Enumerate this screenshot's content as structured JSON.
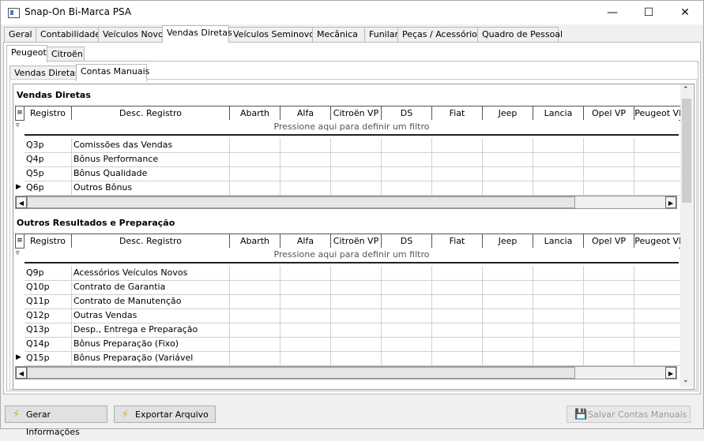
{
  "window": {
    "title": "Snap-On Bi-Marca PSA"
  },
  "main_tabs": [
    "Geral",
    "Contabilidade",
    "Veículos Novos",
    "Vendas Diretas",
    "Veículos Seminovos",
    "Mecânica",
    "Funilaria",
    "Peças / Acessórios",
    "Quadro de Pessoal"
  ],
  "brand_tabs": [
    "Peugeot",
    "Citroën"
  ],
  "sub_tabs": [
    "Vendas Diretas",
    "Contas Manuais"
  ],
  "columns": [
    "Registro",
    "Desc. Registro",
    "Abarth",
    "Alfa",
    "Citroën VP",
    "DS",
    "Fiat",
    "Jeep",
    "Lancia",
    "Opel VP",
    "Peugeot VP"
  ],
  "filter_hint": "Pressione aqui para definir um filtro",
  "section1": {
    "title": "Vendas Diretas",
    "rows": [
      {
        "reg": "Q3p",
        "desc": "Comissões das Vendas"
      },
      {
        "reg": "Q4p",
        "desc": "Bônus Performance"
      },
      {
        "reg": "Q5p",
        "desc": "Bônus Qualidade"
      },
      {
        "reg": "Q6p",
        "desc": "Outros Bônus"
      }
    ]
  },
  "section2": {
    "title": "Outros Resultados e Preparação",
    "rows": [
      {
        "reg": "Q9p",
        "desc": "Acessórios Veículos Novos"
      },
      {
        "reg": "Q10p",
        "desc": "Contrato de Garantia"
      },
      {
        "reg": "Q11p",
        "desc": "Contrato de Manutenção"
      },
      {
        "reg": "Q12p",
        "desc": "Outras Vendas"
      },
      {
        "reg": "Q13p",
        "desc": "Desp., Entrega e Preparação"
      },
      {
        "reg": "Q14p",
        "desc": "Bônus Preparação (Fixo)"
      },
      {
        "reg": "Q15p",
        "desc": "Bônus Preparação (Variável"
      }
    ]
  },
  "buttons": {
    "gerar": "Gerar Informações",
    "exportar": "Exportar Arquivo",
    "salvar": "Salvar Contas Manuais"
  }
}
